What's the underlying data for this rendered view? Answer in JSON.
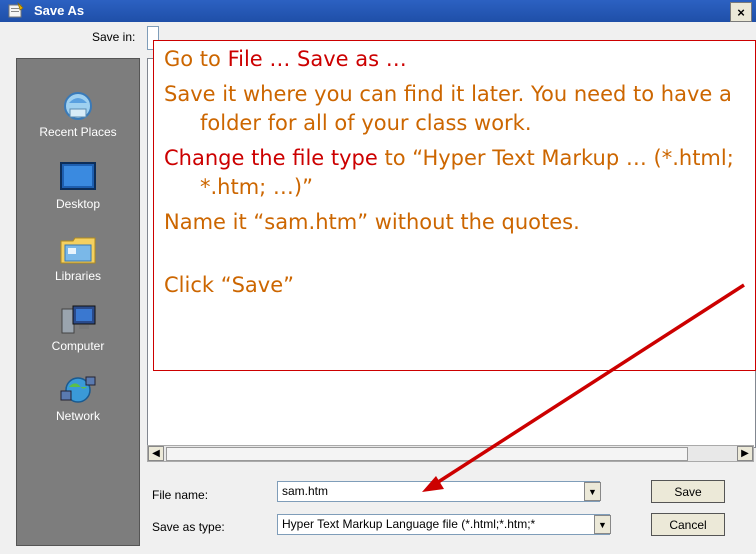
{
  "window": {
    "title": "Save As",
    "close_label": "×"
  },
  "save_in": {
    "label": "Save in:"
  },
  "places": [
    {
      "label": "Recent Places",
      "icon": "recent-places-icon"
    },
    {
      "label": "Desktop",
      "icon": "desktop-icon"
    },
    {
      "label": "Libraries",
      "icon": "libraries-icon"
    },
    {
      "label": "Computer",
      "icon": "computer-icon"
    },
    {
      "label": "Network",
      "icon": "network-icon"
    }
  ],
  "form": {
    "file_name_label": "File name:",
    "file_name_value": "sam.htm",
    "save_type_label": "Save as type:",
    "save_type_value": "Hyper Text Markup Language file (*.html;*.htm;*",
    "save_button": "Save",
    "cancel_button": "Cancel"
  },
  "overlay": {
    "line1_a": "Go to ",
    "line1_b": "File … Save as …",
    "line2": "Save it where you can find it later.  You need to have a folder for all of your class work.",
    "line3_a": "Change the file type",
    "line3_b": " to “Hyper Text Markup … (*.html; *.htm; …)”",
    "line4": "Name it “sam.htm” without the quotes.",
    "line5": "Click “Save”"
  },
  "colors": {
    "title_bar": "#2c61c2",
    "annotation_text": "#cc6600",
    "annotation_highlight": "#cc0000",
    "arrow": "#cc0000"
  }
}
